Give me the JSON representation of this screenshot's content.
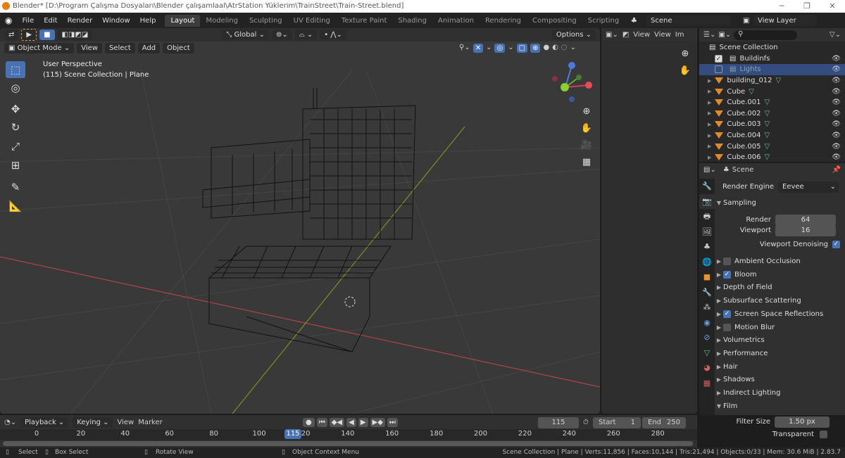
{
  "window": {
    "title": "Blender* [D:\\Program Çalışma Dosyaları\\Blender çalışamlaal\\AtrStation Yüklerim\\TrainStreet\\Train-Street.blend]",
    "minimize": "─",
    "maximize": "❐",
    "close": "✕"
  },
  "menu": [
    "File",
    "Edit",
    "Render",
    "Window",
    "Help"
  ],
  "workspaces": [
    "Layout",
    "Modeling",
    "Sculpting",
    "UV Editing",
    "Texture Paint",
    "Shading",
    "Animation",
    "Rendering",
    "Compositing",
    "Scripting",
    "+"
  ],
  "scene": {
    "name": "Scene",
    "view_layer": "View Layer"
  },
  "viewport": {
    "orientation": "Global",
    "options": "Options",
    "mode": "Object Mode",
    "menus": [
      "View",
      "Select",
      "Add",
      "Object"
    ],
    "perspective": "User Perspective",
    "collection": "(115) Scene Collection | Plane",
    "colors": {
      "x_axis": "#c04848",
      "y_axis": "#8a9a20",
      "grid": "#444444",
      "wire": "#0a0a0a"
    }
  },
  "image_editor": {
    "menus": [
      "View",
      "View",
      "Im"
    ]
  },
  "outliner": {
    "root": "Scene Collection",
    "items": [
      {
        "name": "Buildinfs",
        "type": "collection",
        "checked": true
      },
      {
        "name": "Lights",
        "type": "collection",
        "checked": false,
        "selected": true
      },
      {
        "name": "building_012",
        "type": "mesh"
      },
      {
        "name": "Cube",
        "type": "mesh"
      },
      {
        "name": "Cube.001",
        "type": "mesh"
      },
      {
        "name": "Cube.002",
        "type": "mesh"
      },
      {
        "name": "Cube.003",
        "type": "mesh"
      },
      {
        "name": "Cube.004",
        "type": "mesh"
      },
      {
        "name": "Cube.005",
        "type": "mesh"
      },
      {
        "name": "Cube.006",
        "type": "mesh"
      }
    ]
  },
  "properties": {
    "context": "Scene",
    "render_engine_label": "Render Engine",
    "render_engine": "Eevee",
    "sampling": {
      "label": "Sampling",
      "render_label": "Render",
      "render": "64",
      "viewport_label": "Viewport",
      "viewport": "16",
      "denoise_label": "Viewport Denoising",
      "denoise": true
    },
    "panels": [
      {
        "label": "Ambient Occlusion",
        "checkbox": false
      },
      {
        "label": "Bloom",
        "checkbox": true
      },
      {
        "label": "Depth of Field"
      },
      {
        "label": "Subsurface Scattering"
      },
      {
        "label": "Screen Space Reflections",
        "checkbox": true
      },
      {
        "label": "Motion Blur",
        "checkbox": false
      },
      {
        "label": "Volumetrics"
      },
      {
        "label": "Performance"
      },
      {
        "label": "Hair"
      },
      {
        "label": "Shadows"
      },
      {
        "label": "Indirect Lighting"
      }
    ],
    "film": {
      "label": "Film",
      "filter_label": "Filter Size",
      "filter": "1.50 px",
      "transparent_label": "Transparent",
      "transparent": false
    }
  },
  "timeline": {
    "menus": [
      "Playback",
      "Keying",
      "View",
      "Marker"
    ],
    "current": "115",
    "start_label": "Start",
    "start": "1",
    "end_label": "End",
    "end": "250",
    "ticks": [
      "0",
      "20",
      "40",
      "60",
      "80",
      "100",
      "120",
      "140",
      "160",
      "180",
      "200",
      "220",
      "240",
      "260",
      "280"
    ]
  },
  "status": {
    "select": "Select",
    "box_select": "Box Select",
    "rotate": "Rotate View",
    "context": "Object Context Menu",
    "stats": "Scene Collection | Plane | Verts:11,856 | Faces:10,144 | Tris:21,494 | Objects:0/33 | Mem: 30.6 MiB | 2.83.7"
  }
}
